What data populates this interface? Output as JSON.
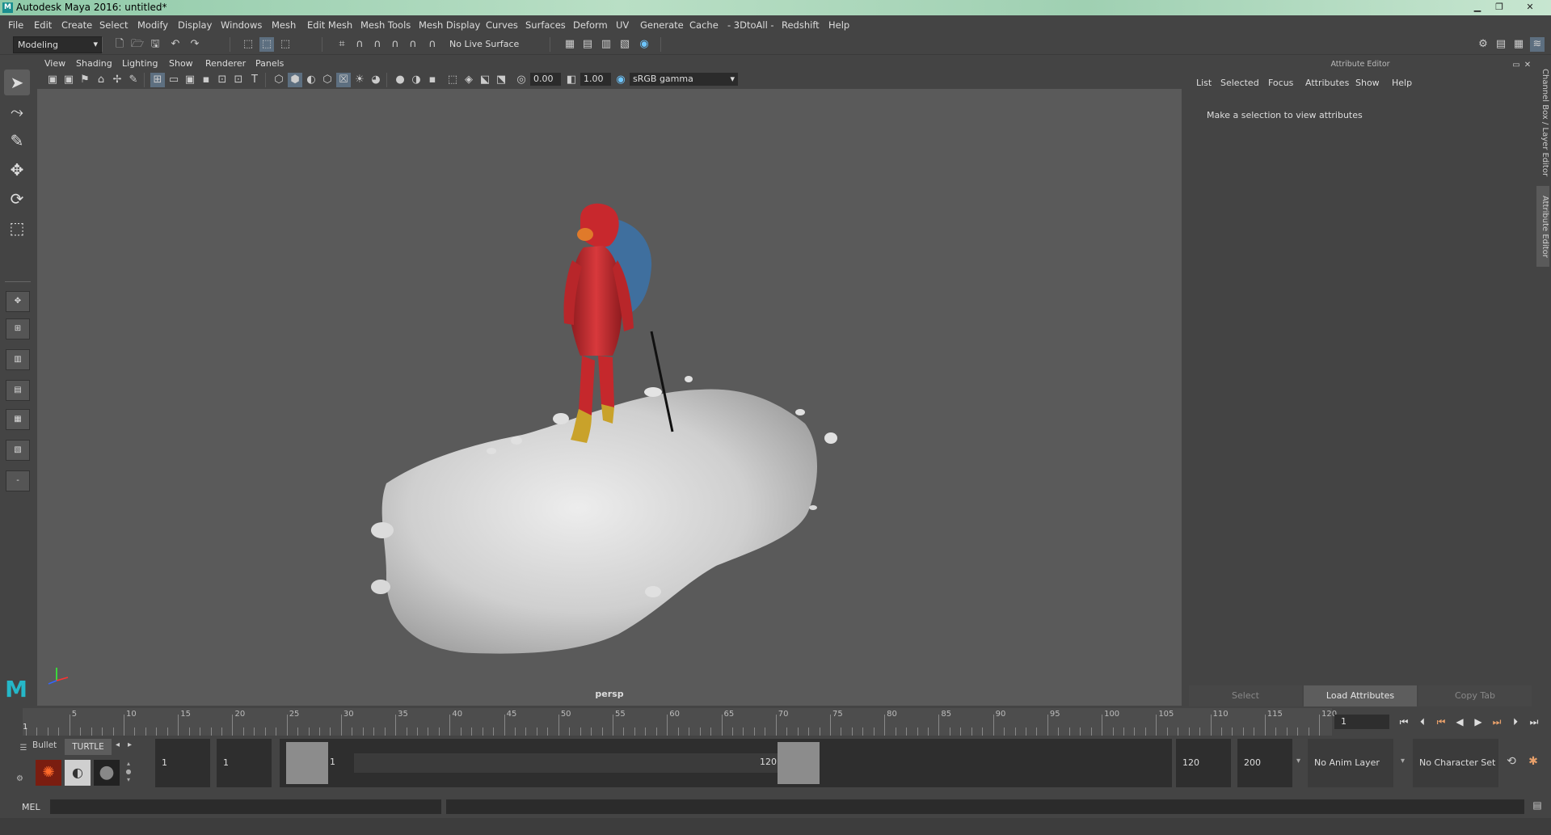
{
  "window": {
    "title": "Autodesk Maya 2016: untitled*",
    "logo": "M"
  },
  "menubar": [
    "File",
    "Edit",
    "Create",
    "Select",
    "Modify",
    "Display",
    "Windows",
    "Mesh",
    "Edit Mesh",
    "Mesh Tools",
    "Mesh Display",
    "Curves",
    "Surfaces",
    "Deform",
    "UV",
    "Generate",
    "Cache",
    "- 3DtoAll -",
    "Redshift",
    "Help"
  ],
  "statusline": {
    "workspace": "Modeling",
    "live_surface": "No Live Surface"
  },
  "viewport": {
    "menu": [
      "View",
      "Shading",
      "Lighting",
      "Show",
      "Renderer",
      "Panels"
    ],
    "exposure": "0.00",
    "gamma": "1.00",
    "color_space": "sRGB gamma",
    "camera": "persp"
  },
  "attribute_editor": {
    "title": "Attribute Editor",
    "menu": [
      "List",
      "Selected",
      "Focus",
      "Attributes",
      "Show",
      "Help"
    ],
    "message": "Make a selection to view attributes",
    "buttons": {
      "select": "Select",
      "load": "Load Attributes",
      "copy": "Copy Tab"
    },
    "side_tabs": {
      "channel_box": "Channel Box / Layer Editor",
      "attribute_editor": "Attribute Editor"
    }
  },
  "timeline": {
    "ticks": [
      "5",
      "10",
      "15",
      "20",
      "25",
      "30",
      "35",
      "40",
      "45",
      "50",
      "55",
      "60",
      "65",
      "70",
      "75",
      "80",
      "85",
      "90",
      "95",
      "100",
      "105",
      "110",
      "115",
      "120"
    ],
    "current_frame_marker": "1",
    "current_time": "1"
  },
  "range": {
    "shelf_tabs": [
      "Bullet",
      "TURTLE"
    ],
    "start_time": "1",
    "playback_start": "1",
    "slider_start": "1",
    "slider_end": "120",
    "playback_end": "120",
    "end_time": "200",
    "anim_layer": "No Anim Layer",
    "character_set": "No Character Set"
  },
  "command": {
    "language": "MEL"
  }
}
